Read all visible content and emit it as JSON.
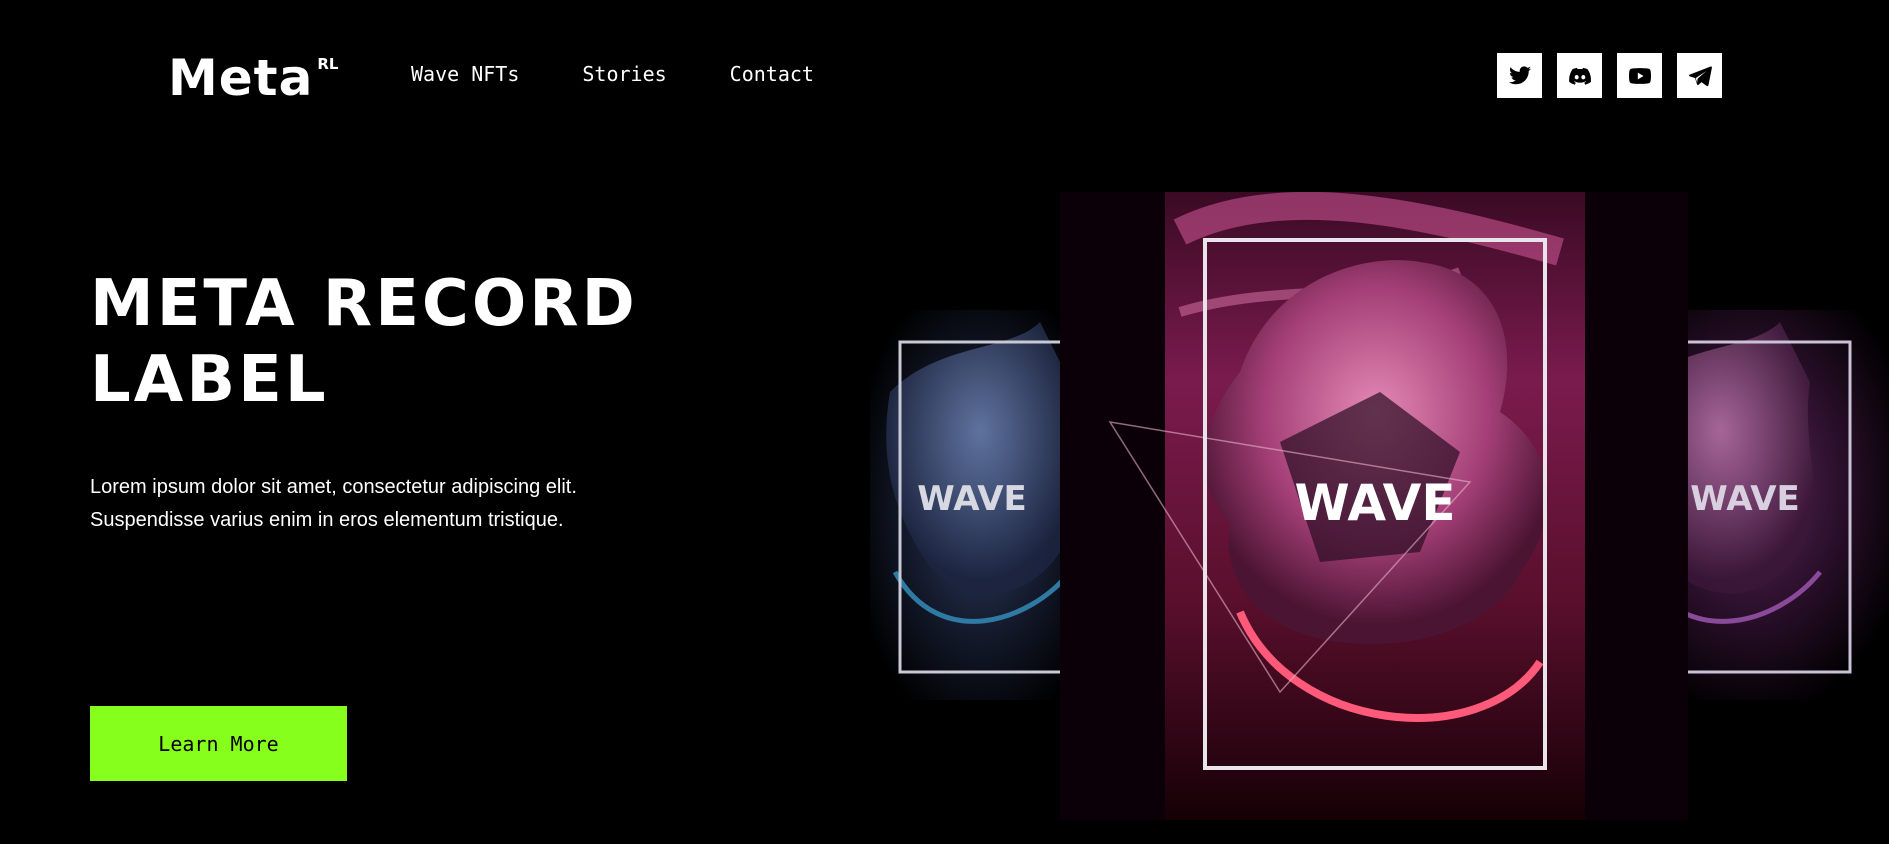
{
  "header": {
    "logo": {
      "main": "Meta",
      "sup": "RL"
    },
    "nav": [
      {
        "label": "Wave NFTs"
      },
      {
        "label": "Stories"
      },
      {
        "label": "Contact"
      }
    ],
    "socials": [
      {
        "icon": "twitter-icon"
      },
      {
        "icon": "discord-icon"
      },
      {
        "icon": "youtube-icon"
      },
      {
        "icon": "telegram-icon"
      }
    ]
  },
  "hero": {
    "title_line1": "META RECORD",
    "title_line2": "LABEL",
    "text": "Lorem ipsum dolor sit amet, consectetur adipiscing elit. Suspendisse varius enim in eros elementum tristique.",
    "cta_label": "Learn More"
  },
  "artwork": {
    "left_card_label": "WAVE",
    "center_card_label": "WAVE",
    "right_card_label": "WAVE"
  },
  "colors": {
    "background": "#000000",
    "accent": "#86ff1c",
    "text": "#ffffff",
    "pink": "#c2185b",
    "teal": "#1f5a78",
    "purple": "#6b2a5c"
  }
}
